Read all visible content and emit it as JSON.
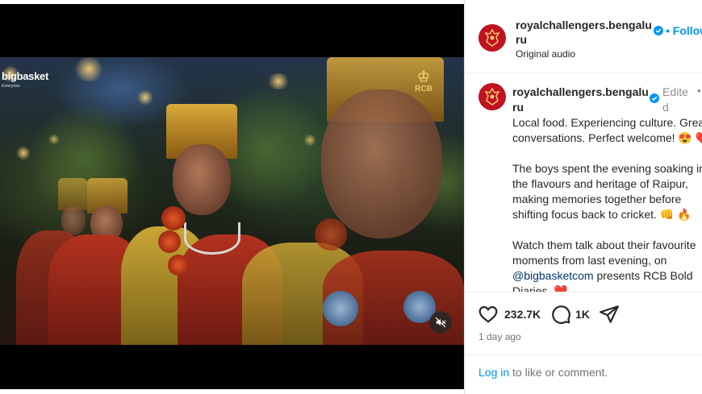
{
  "video": {
    "watermark_left": "bigbasket",
    "watermark_left_sub": "Enterprise",
    "watermark_right": "RCB",
    "mute_icon": "speaker-muted-icon"
  },
  "header": {
    "username": "royalchallengers.bengaluru",
    "verified_icon": "verified-badge-icon",
    "follow_label": "• Follow",
    "audio_label": "Original audio"
  },
  "caption": {
    "username": "royalchallengers.bengaluru",
    "edited_label": "Edited",
    "more_label": "•",
    "line1": "Local food. Experiencing culture. Great",
    "line2": "conversations. Perfect welcome! 😍 ❤️",
    "line3": "The boys spent the evening soaking in",
    "line4": "the flavours and heritage of Raipur,",
    "line5": "making memories together before",
    "line6": "shifting focus back to cricket. 👊 🔥",
    "line7": "Watch them talk about their favourite",
    "line8": "moments from last evening, on",
    "mention": "@bigbasketcom",
    "line9_rest": " presents RCB Bold",
    "line10": "Diaries. ❤️"
  },
  "actions": {
    "like_count": "232.7K",
    "comment_count": "1K",
    "timestamp": "1 day ago"
  },
  "footer": {
    "login_link": "Log in",
    "login_rest": " to like or comment."
  },
  "colors": {
    "brand_red": "#c1121f",
    "link_blue": "#0095f6",
    "mention_blue": "#00376b"
  }
}
